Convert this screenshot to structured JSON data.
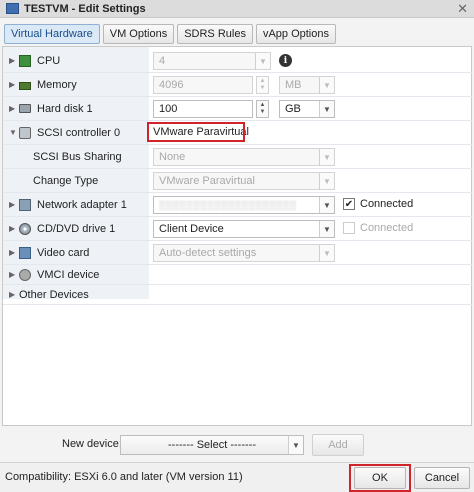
{
  "window": {
    "title": "TESTVM - Edit Settings"
  },
  "tabs": [
    {
      "label": "Virtual Hardware",
      "active": true
    },
    {
      "label": "VM Options",
      "active": false
    },
    {
      "label": "SDRS Rules",
      "active": false
    },
    {
      "label": "vApp Options",
      "active": false
    }
  ],
  "hardware": {
    "cpu": {
      "label": "CPU",
      "value": "4"
    },
    "memory": {
      "label": "Memory",
      "value": "4096",
      "unit": "MB"
    },
    "hard_disk": {
      "label": "Hard disk 1",
      "value": "100",
      "unit": "GB"
    },
    "scsi": {
      "label": "SCSI controller 0",
      "value": "VMware Paravirtual"
    },
    "scsi_bus": {
      "label": "SCSI Bus Sharing",
      "value": "None"
    },
    "change_type": {
      "label": "Change Type",
      "value": "VMware Paravirtual"
    },
    "network": {
      "label": "Network adapter 1",
      "connected_label": "Connected",
      "connected": true
    },
    "cd_dvd": {
      "label": "CD/DVD drive 1",
      "value": "Client Device",
      "connected_label": "Connected",
      "connected": false
    },
    "video": {
      "label": "Video card",
      "value": "Auto-detect settings"
    },
    "vmci": {
      "label": "VMCI device"
    },
    "other": {
      "label": "Other Devices"
    }
  },
  "new_device": {
    "label": "New device:",
    "select_value": "------- Select -------",
    "add_label": "Add"
  },
  "footer": {
    "compatibility": "Compatibility: ESXi 6.0 and later (VM version 11)",
    "ok_label": "OK",
    "cancel_label": "Cancel"
  },
  "colors": {
    "highlight_border": "#d0232a",
    "active_tab": "#dbe8f6"
  }
}
